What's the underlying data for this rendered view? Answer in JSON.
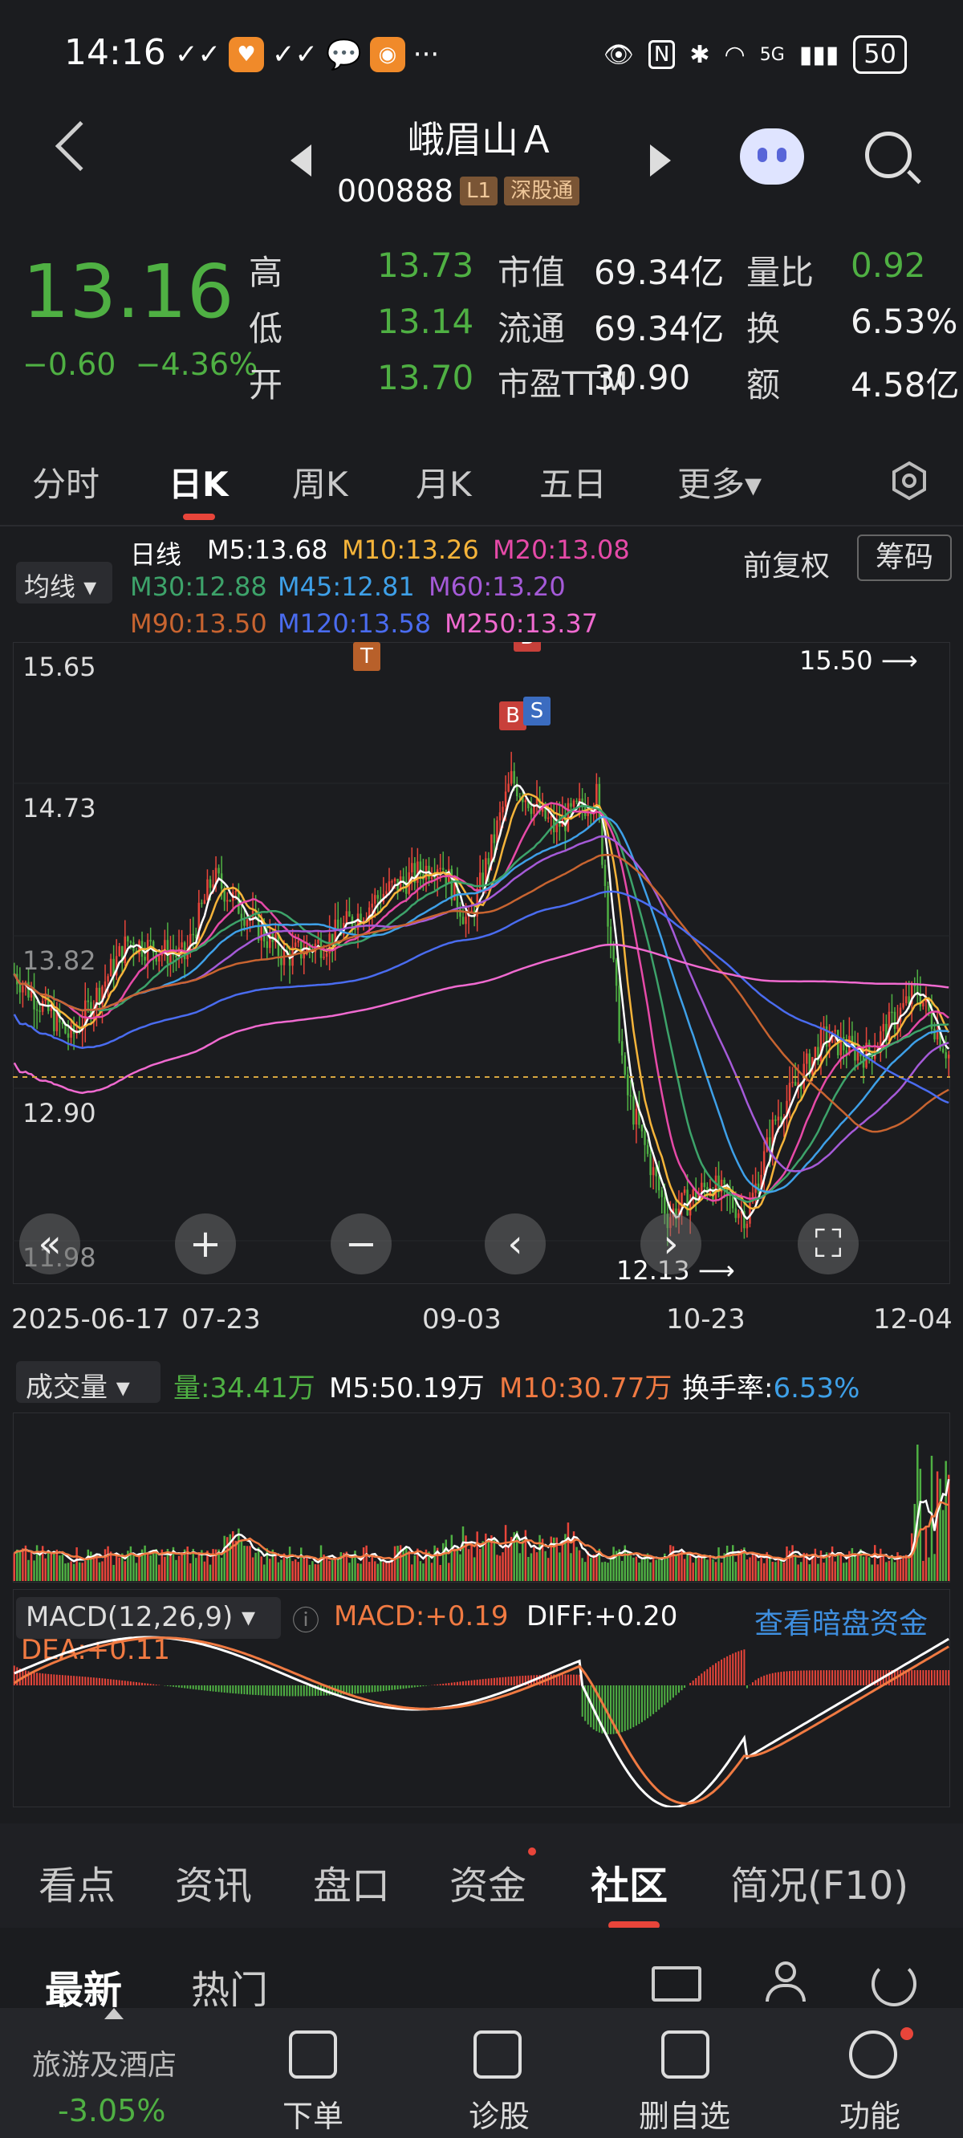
{
  "status": {
    "time": "14:16",
    "network": "5G",
    "battery": "50"
  },
  "header": {
    "name": "峨眉山Ａ",
    "code": "000888",
    "tags": [
      "L1",
      "深股通"
    ]
  },
  "quote": {
    "price": "13.16",
    "change": "−0.60",
    "change_pct": "−4.36%",
    "rows": [
      {
        "l1": "高",
        "v1": "13.73",
        "l2": "市值",
        "v2": "69.34亿",
        "l3": "量比",
        "v3": "0.92"
      },
      {
        "l1": "低",
        "v1": "13.14",
        "l2": "流通",
        "v2": "69.34亿",
        "l3": "换",
        "v3": "6.53%"
      },
      {
        "l1": "开",
        "v1": "13.70",
        "l2": "市盈TTM",
        "v2": "30.90",
        "l3": "额",
        "v3": "4.58亿"
      }
    ]
  },
  "tabs": [
    "分时",
    "日K",
    "周K",
    "月K",
    "五日",
    "更多▾"
  ],
  "ma": {
    "btn": "均线 ▾",
    "line": "日线",
    "m5": "M5:13.68",
    "m10": "M10:13.26",
    "m20": "M20:13.08",
    "m30": "M30:12.88",
    "m45": "M45:12.81",
    "m60": "M60:13.20",
    "m90": "M90:13.50",
    "m120": "M120:13.58",
    "m250": "M250:13.37",
    "adjust": "前复权",
    "chip": "筹码"
  },
  "chart": {
    "y_ticks": [
      "15.65",
      "14.73",
      "13.82",
      "12.90",
      "11.98"
    ],
    "x_ticks": [
      "2025-06-17",
      "07-23",
      "09-03",
      "10-23",
      "12-04"
    ],
    "high_mark": "15.50",
    "low_mark": "12.13"
  },
  "volume": {
    "btn": "成交量 ▾",
    "q": "量:34.41万",
    "m5": "M5:50.19万",
    "m10": "M10:30.77万",
    "turnover_label": "换手率:",
    "turnover": "6.53%"
  },
  "macd": {
    "btn": "MACD(12,26,9) ▾",
    "macd": "MACD:+0.19",
    "diff": "DIFF:+0.20",
    "dea": "DEA:+0.11",
    "link": "查看暗盘资金"
  },
  "bottom_tabs": [
    "看点",
    "资讯",
    "盘口",
    "资金",
    "社区",
    "简况(F10)"
  ],
  "community": {
    "latest": "最新",
    "hot": "热门"
  },
  "toolbar": {
    "sector": "旅游及酒店",
    "sector_chg": "-3.05%",
    "items": [
      "下单",
      "诊股",
      "删自选",
      "功能"
    ]
  },
  "colors": {
    "down": "#4fb043",
    "up": "#e8453a",
    "accent": "#e8453a"
  }
}
